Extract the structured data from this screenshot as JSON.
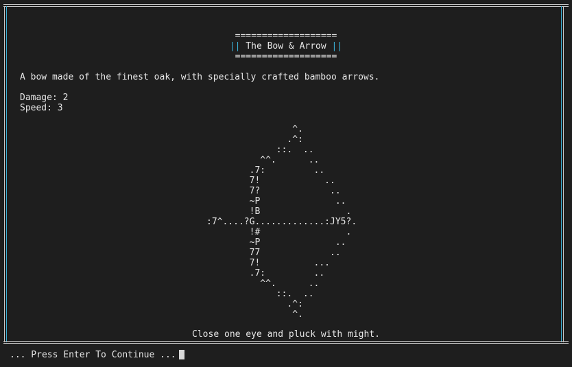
{
  "card": {
    "title_rule": "===================",
    "title_bar_left": "||",
    "title": "The Bow & Arrow",
    "title_bar_right": "||",
    "description": "A bow made of the finest oak, with specially crafted bamboo arrows.",
    "damage_label": "Damage: 2",
    "speed_label": "Speed: 3",
    "ascii_art": "                ^.\n               .^:\n             ::.  ..\n          ^^.      ..\n        .7:         ..\n        7!            ..\n        7?             ..\n        ~P              ..\n        !B                .\n:7^....?G.............:JY5?.\n        !#                .\n        ~P              ..\n        77             ..\n        7!          ...\n        .7:         ..\n          ^^.      ..\n             ::.  ..\n               .^:\n                ^.",
    "flavor_text": "Close one eye and pluck with might."
  },
  "prompt": {
    "text": "... Press Enter To Continue ..."
  },
  "colors": {
    "background": "#1e1e1e",
    "text": "#e6e6e6",
    "border": "#c8c8c8",
    "accent": "#3ab0d6"
  }
}
